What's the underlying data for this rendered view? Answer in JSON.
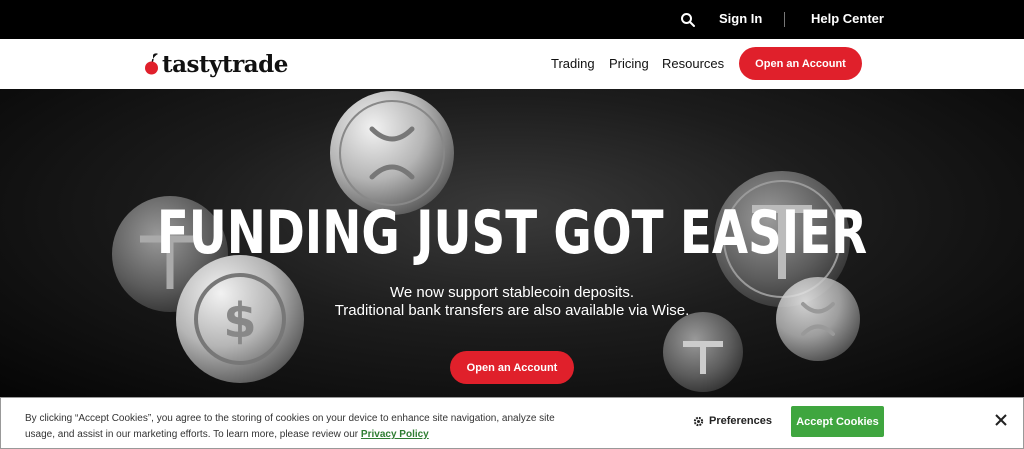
{
  "topbar": {
    "search_icon": "search-icon",
    "sign_in": "Sign In",
    "help_center": "Help Center"
  },
  "nav": {
    "logo_text": "tastytrade",
    "links": [
      "Trading",
      "Pricing",
      "Resources"
    ],
    "cta": "Open an Account"
  },
  "hero": {
    "headline": "FUNDING JUST GOT EASIER",
    "subline1": "We now support stablecoin deposits.",
    "subline2": "Traditional bank transfers are also available via Wise.",
    "cta": "Open an Account"
  },
  "cookie": {
    "message": "By clicking “Accept Cookies”, you agree to the storing of cookies on your device to enhance site navigation, analyze site usage, and assist in our marketing efforts. To learn more, please review our ",
    "policy_link": "Privacy Policy",
    "preferences": "Preferences",
    "accept": "Accept Cookies"
  },
  "colors": {
    "brand_red": "#e0202b",
    "accept_green": "#3fa63f",
    "link_green": "#2e7d32"
  }
}
